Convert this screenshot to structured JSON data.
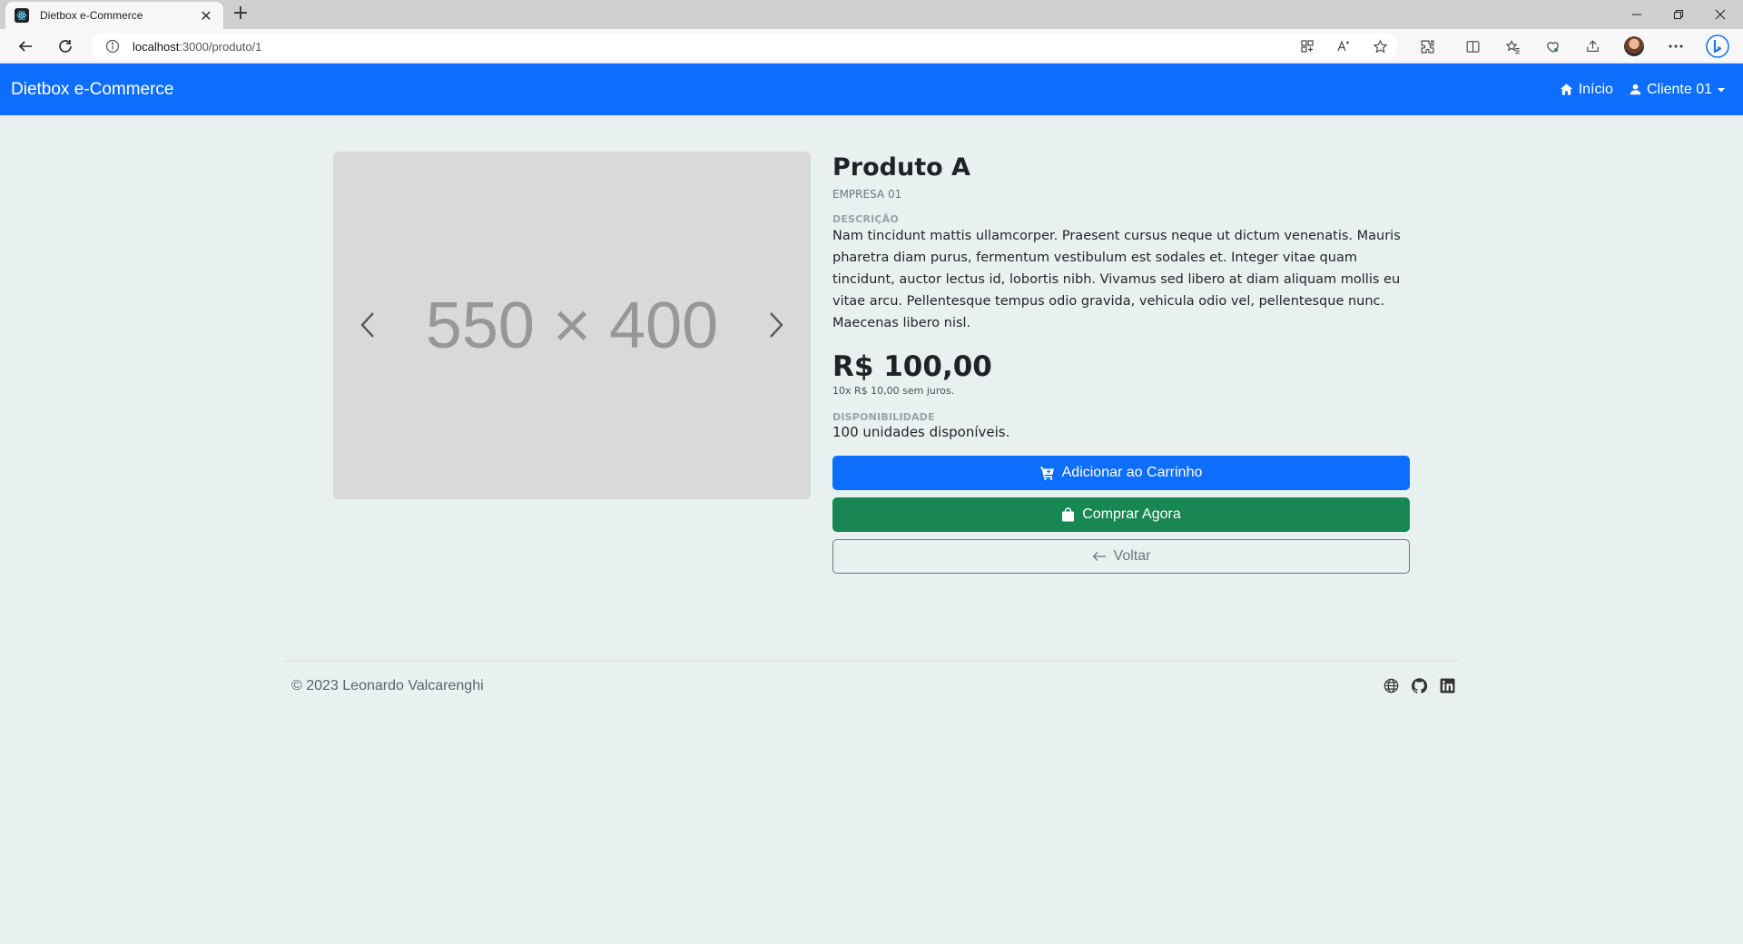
{
  "browser": {
    "tab_title": "Dietbox e-Commerce",
    "url_host": "localhost",
    "url_path": ":3000/produto/1"
  },
  "navbar": {
    "brand": "Dietbox e-Commerce",
    "home_label": "Início",
    "user_label": "Cliente 01"
  },
  "product": {
    "image_placeholder": "550 × 400",
    "name": "Produto A",
    "company": "EMPRESA 01",
    "description_label": "DESCRIÇÃO",
    "description": "Nam tincidunt mattis ullamcorper. Praesent cursus neque ut dictum venenatis. Mauris pharetra diam purus, fermentum vestibulum est sodales et. Integer vitae quam tincidunt, auctor lectus id, lobortis nibh. Vivamus sed libero at diam aliquam mollis eu vitae arcu. Pellentesque tempus odio gravida, vehicula odio vel, pellentesque nunc. Maecenas libero nisl.",
    "price": "R$ 100,00",
    "installments": "10x R$ 10,00 sem juros.",
    "availability_label": "DISPONIBILIDADE",
    "availability": "100 unidades disponíveis."
  },
  "actions": {
    "add_to_cart": "Adicionar ao Carrinho",
    "buy_now": "Comprar Agora",
    "back": "Voltar"
  },
  "footer": {
    "copyright": "© 2023 Leonardo Valcarenghi",
    "icons": [
      "globe-icon",
      "github-icon",
      "linkedin-icon"
    ]
  },
  "colors": {
    "primary": "#0d6efd",
    "success": "#198754",
    "page_bg": "#e8f1f0"
  }
}
